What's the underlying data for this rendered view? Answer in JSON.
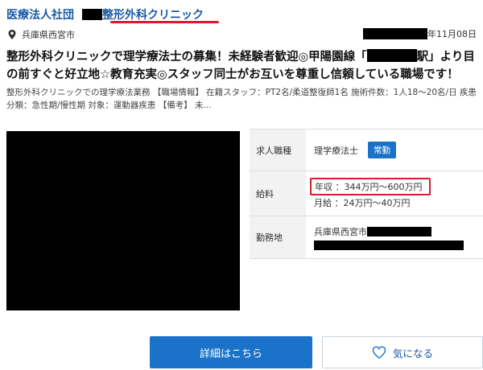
{
  "header": {
    "org_name": "医療法人社団",
    "clinic_name": "整形外科クリニック"
  },
  "location": {
    "icon": "map-pin-icon",
    "text": "兵庫県西宮市"
  },
  "posting": {
    "date_suffix": "年11月08日"
  },
  "title": {
    "part1": "整形外科クリニックで理学療法士の募集！未経験者歓迎◎甲陽園線「",
    "part2": "駅」より目の前すぐと好立地☆教育充実◎スタッフ同士がお互いを尊重し信頼している職場です！"
  },
  "description": "整形外科クリニックでの理学療法業務 【職場情報】 在籍スタッフ：PT2名/柔道整復師1名 施術件数：1人18～20名/日 疾患分類：急性期/慢性期 対象：運動器疾患 【備考】 未...",
  "details": {
    "job_label": "求人職種",
    "job_value": "理学療法士",
    "employment_badge": "常勤",
    "salary_label": "給料",
    "salary_annual": "年収 ：344万円～600万円",
    "salary_monthly": "月給 ：24万円～40万円",
    "location_label": "勤務地",
    "location_value": "兵庫県西宮市"
  },
  "buttons": {
    "detail_label": "詳細はこちら",
    "favorite_label": "気になる"
  },
  "colors": {
    "brand_blue": "#1a5aa8",
    "button_blue": "#1a73c9",
    "highlight_red": "#d81b30"
  }
}
